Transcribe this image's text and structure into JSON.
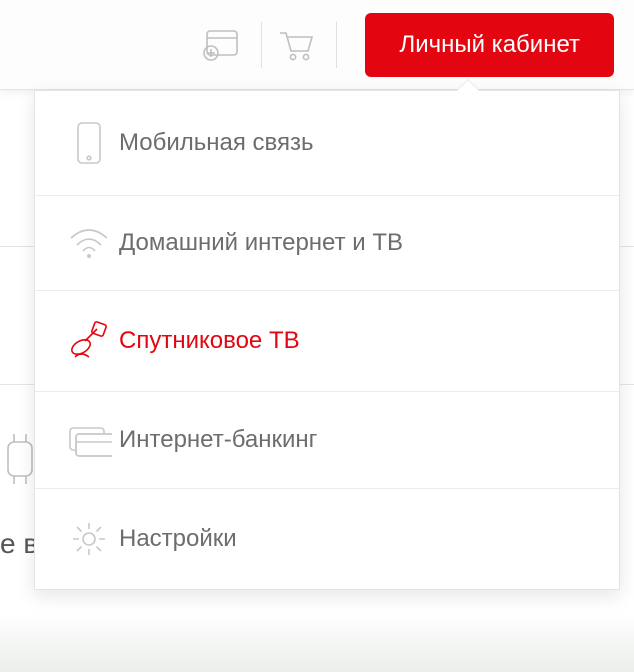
{
  "topbar": {
    "login_button": "Личный кабинет"
  },
  "dropdown": {
    "items": [
      {
        "label": "Мобильная связь",
        "icon": "phone",
        "active": false
      },
      {
        "label": "Домашний интернет и ТВ",
        "icon": "wifi",
        "active": false
      },
      {
        "label": "Спутниковое ТВ",
        "icon": "satellite",
        "active": true
      },
      {
        "label": "Интернет-банкинг",
        "icon": "card",
        "active": false
      },
      {
        "label": "Настройки",
        "icon": "gear",
        "active": false
      }
    ]
  },
  "background": {
    "partial_text": "е в"
  },
  "colors": {
    "accent": "#e30611",
    "text_muted": "#6d6d6d",
    "icon_muted": "#c8c8c8",
    "border": "#e4e4e4"
  }
}
